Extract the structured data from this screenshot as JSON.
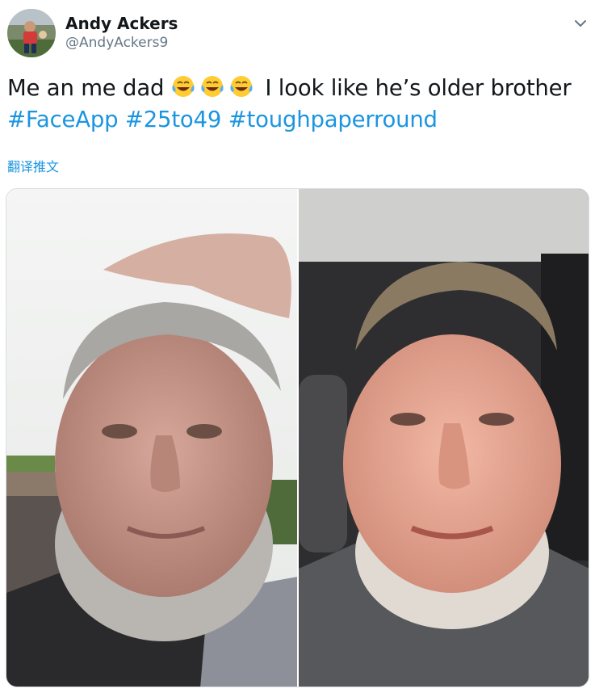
{
  "tweet": {
    "author": {
      "name": "Andy Ackers",
      "handle": "@AndyAckers9"
    },
    "text_segments": {
      "line_start": "Me an me dad",
      "line_end": " I look like he’s older brother",
      "emoji": [
        "face-with-tears-of-joy",
        "face-with-tears-of-joy",
        "face-with-tears-of-joy"
      ]
    },
    "hashtags": [
      "#FaceApp",
      "#25to49",
      "#toughpaperround"
    ],
    "translate_label": "翻译推文",
    "media": {
      "count": 2,
      "images": [
        {
          "label": "left-photo"
        },
        {
          "label": "right-photo"
        }
      ]
    }
  },
  "colors": {
    "text": "#14171a",
    "secondary": "#657786",
    "link": "#1b95e0",
    "border": "#d8dee3"
  }
}
